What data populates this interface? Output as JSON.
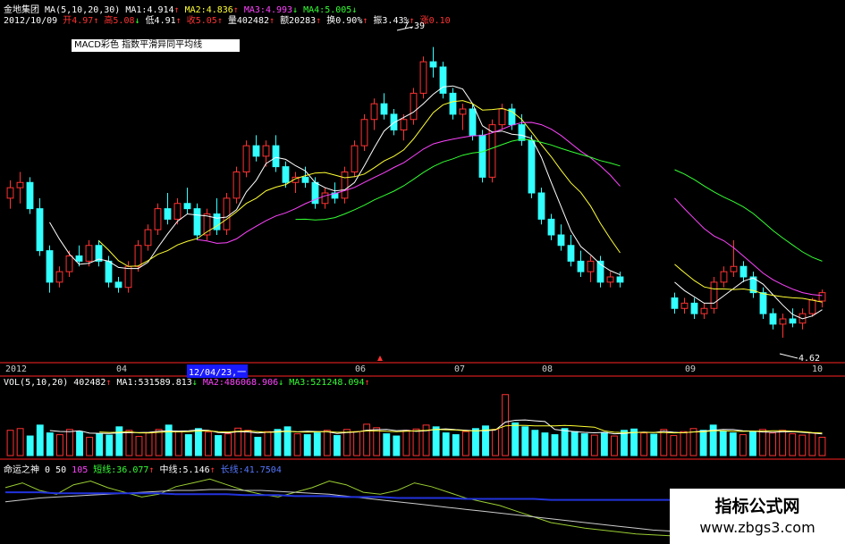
{
  "header": {
    "stock_name": "金地集团",
    "ma_params": "MA(5,10,20,30)",
    "ma1": "MA1:4.914",
    "ma2": "MA2:4.836",
    "ma3": "MA3:4.993",
    "ma4": "MA4:5.005",
    "date": "2012/10/09",
    "open": "开4.97",
    "high": "高5.08",
    "low": "低4.91",
    "close": "收5.05",
    "volume": "量402482",
    "amount": "额20283",
    "turnover": "换0.90%",
    "amplitude": "振3.43%",
    "change": "涨0.10"
  },
  "legend_box": "MACD彩色    指数平滑异同平均线",
  "price_chart": {
    "high_label": "7.39",
    "low_label": "4.62"
  },
  "x_axis": {
    "labels": [
      "2012",
      "04",
      "06",
      "07",
      "08",
      "09",
      "10"
    ],
    "cursor_date": "12/04/23,一"
  },
  "volume_panel": {
    "params": "VOL(5,10,20)",
    "vol": "402482",
    "ma1": "MA1:531589.813",
    "ma2": "MA2:486068.906",
    "ma3": "MA3:521248.094"
  },
  "indicator_panel": {
    "name": "命运之神",
    "p1": "0",
    "p2": "50",
    "p3": "105",
    "short": "短线:36.077",
    "mid": "中线:5.146",
    "long": "长线:41.7504"
  },
  "watermark": {
    "title": "指标公式网",
    "url": "www.zbgs3.com"
  },
  "colors": {
    "up": "#ff3333",
    "down": "#33ffff",
    "ma5": "#ffffff",
    "ma10": "#ffff33",
    "ma20": "#ff44ff",
    "ma30": "#33ff33"
  },
  "chart_data": [
    {
      "type": "candlestick",
      "title": "",
      "period": [
        "2012-01",
        "2012-10"
      ],
      "ylim": [
        4.4,
        7.6
      ],
      "candles": [
        {
          "o": 5.95,
          "h": 6.12,
          "l": 5.85,
          "c": 6.05
        },
        {
          "o": 6.05,
          "h": 6.2,
          "l": 5.9,
          "c": 6.1
        },
        {
          "o": 6.1,
          "h": 6.15,
          "l": 5.8,
          "c": 5.85
        },
        {
          "o": 5.85,
          "h": 5.95,
          "l": 5.4,
          "c": 5.45
        },
        {
          "o": 5.45,
          "h": 5.5,
          "l": 5.05,
          "c": 5.15
        },
        {
          "o": 5.15,
          "h": 5.3,
          "l": 5.1,
          "c": 5.25
        },
        {
          "o": 5.25,
          "h": 5.45,
          "l": 5.2,
          "c": 5.4
        },
        {
          "o": 5.4,
          "h": 5.5,
          "l": 5.3,
          "c": 5.35
        },
        {
          "o": 5.35,
          "h": 5.55,
          "l": 5.3,
          "c": 5.5
        },
        {
          "o": 5.5,
          "h": 5.55,
          "l": 5.3,
          "c": 5.35
        },
        {
          "o": 5.35,
          "h": 5.4,
          "l": 5.1,
          "c": 5.15
        },
        {
          "o": 5.15,
          "h": 5.2,
          "l": 5.05,
          "c": 5.1
        },
        {
          "o": 5.1,
          "h": 5.35,
          "l": 5.05,
          "c": 5.3
        },
        {
          "o": 5.3,
          "h": 5.55,
          "l": 5.25,
          "c": 5.5
        },
        {
          "o": 5.5,
          "h": 5.7,
          "l": 5.45,
          "c": 5.65
        },
        {
          "o": 5.65,
          "h": 5.9,
          "l": 5.6,
          "c": 5.85
        },
        {
          "o": 5.85,
          "h": 6.0,
          "l": 5.7,
          "c": 5.75
        },
        {
          "o": 5.75,
          "h": 5.95,
          "l": 5.7,
          "c": 5.9
        },
        {
          "o": 5.9,
          "h": 6.05,
          "l": 5.8,
          "c": 5.85
        },
        {
          "o": 5.85,
          "h": 5.9,
          "l": 5.55,
          "c": 5.6
        },
        {
          "o": 5.6,
          "h": 5.85,
          "l": 5.55,
          "c": 5.8
        },
        {
          "o": 5.8,
          "h": 5.95,
          "l": 5.6,
          "c": 5.65
        },
        {
          "o": 5.65,
          "h": 6.0,
          "l": 5.6,
          "c": 5.95
        },
        {
          "o": 5.95,
          "h": 6.25,
          "l": 5.9,
          "c": 6.2
        },
        {
          "o": 6.2,
          "h": 6.5,
          "l": 6.15,
          "c": 6.45
        },
        {
          "o": 6.45,
          "h": 6.55,
          "l": 6.3,
          "c": 6.35
        },
        {
          "o": 6.35,
          "h": 6.5,
          "l": 6.25,
          "c": 6.45
        },
        {
          "o": 6.45,
          "h": 6.55,
          "l": 6.2,
          "c": 6.25
        },
        {
          "o": 6.25,
          "h": 6.3,
          "l": 6.05,
          "c": 6.1
        },
        {
          "o": 6.1,
          "h": 6.2,
          "l": 6.0,
          "c": 6.15
        },
        {
          "o": 6.15,
          "h": 6.25,
          "l": 6.05,
          "c": 6.1
        },
        {
          "o": 6.1,
          "h": 6.15,
          "l": 5.85,
          "c": 5.9
        },
        {
          "o": 5.9,
          "h": 6.05,
          "l": 5.85,
          "c": 6.0
        },
        {
          "o": 6.0,
          "h": 6.1,
          "l": 5.9,
          "c": 5.95
        },
        {
          "o": 5.95,
          "h": 6.25,
          "l": 5.9,
          "c": 6.2
        },
        {
          "o": 6.2,
          "h": 6.5,
          "l": 6.15,
          "c": 6.45
        },
        {
          "o": 6.45,
          "h": 6.75,
          "l": 6.4,
          "c": 6.7
        },
        {
          "o": 6.7,
          "h": 6.9,
          "l": 6.6,
          "c": 6.85
        },
        {
          "o": 6.85,
          "h": 6.95,
          "l": 6.7,
          "c": 6.75
        },
        {
          "o": 6.75,
          "h": 6.8,
          "l": 6.55,
          "c": 6.6
        },
        {
          "o": 6.6,
          "h": 6.75,
          "l": 6.5,
          "c": 6.7
        },
        {
          "o": 6.7,
          "h": 7.0,
          "l": 6.65,
          "c": 6.95
        },
        {
          "o": 6.95,
          "h": 7.3,
          "l": 6.9,
          "c": 7.25
        },
        {
          "o": 7.25,
          "h": 7.39,
          "l": 7.1,
          "c": 7.2
        },
        {
          "o": 7.2,
          "h": 7.25,
          "l": 6.9,
          "c": 6.95
        },
        {
          "o": 6.95,
          "h": 7.0,
          "l": 6.7,
          "c": 6.75
        },
        {
          "o": 6.75,
          "h": 6.85,
          "l": 6.6,
          "c": 6.8
        },
        {
          "o": 6.8,
          "h": 6.85,
          "l": 6.5,
          "c": 6.55
        },
        {
          "o": 6.55,
          "h": 6.6,
          "l": 6.1,
          "c": 6.15
        },
        {
          "o": 6.15,
          "h": 6.7,
          "l": 6.1,
          "c": 6.65
        },
        {
          "o": 6.65,
          "h": 6.85,
          "l": 6.6,
          "c": 6.8
        },
        {
          "o": 6.8,
          "h": 6.85,
          "l": 6.6,
          "c": 6.65
        },
        {
          "o": 6.65,
          "h": 6.75,
          "l": 6.45,
          "c": 6.5
        },
        {
          "o": 6.5,
          "h": 6.55,
          "l": 5.95,
          "c": 6.0
        },
        {
          "o": 6.0,
          "h": 6.05,
          "l": 5.7,
          "c": 5.75
        },
        {
          "o": 5.75,
          "h": 5.8,
          "l": 5.55,
          "c": 5.6
        },
        {
          "o": 5.6,
          "h": 5.7,
          "l": 5.45,
          "c": 5.5
        },
        {
          "o": 5.5,
          "h": 5.6,
          "l": 5.3,
          "c": 5.35
        },
        {
          "o": 5.35,
          "h": 5.45,
          "l": 5.2,
          "c": 5.25
        },
        {
          "o": 5.25,
          "h": 5.4,
          "l": 5.15,
          "c": 5.35
        },
        {
          "o": 5.35,
          "h": 5.4,
          "l": 5.1,
          "c": 5.15
        },
        {
          "o": 5.15,
          "h": 5.25,
          "l": 5.1,
          "c": 5.2
        },
        {
          "o": 5.2,
          "h": 5.25,
          "l": 5.1,
          "c": 5.15
        },
        {
          "o": 5.0,
          "h": 5.05,
          "l": 4.85,
          "c": 4.9
        },
        {
          "o": 4.9,
          "h": 5.0,
          "l": 4.85,
          "c": 4.95
        },
        {
          "o": 4.95,
          "h": 5.0,
          "l": 4.8,
          "c": 4.85
        },
        {
          "o": 4.85,
          "h": 4.95,
          "l": 4.8,
          "c": 4.9
        },
        {
          "o": 4.9,
          "h": 5.2,
          "l": 4.85,
          "c": 5.15
        },
        {
          "o": 5.15,
          "h": 5.3,
          "l": 5.1,
          "c": 5.25
        },
        {
          "o": 5.25,
          "h": 5.55,
          "l": 5.2,
          "c": 5.3
        },
        {
          "o": 5.3,
          "h": 5.35,
          "l": 5.15,
          "c": 5.2
        },
        {
          "o": 5.2,
          "h": 5.25,
          "l": 5.0,
          "c": 5.05
        },
        {
          "o": 5.05,
          "h": 5.1,
          "l": 4.8,
          "c": 4.85
        },
        {
          "o": 4.85,
          "h": 4.9,
          "l": 4.7,
          "c": 4.75
        },
        {
          "o": 4.75,
          "h": 4.85,
          "l": 4.62,
          "c": 4.8
        },
        {
          "o": 4.8,
          "h": 4.9,
          "l": 4.72,
          "c": 4.76
        },
        {
          "o": 4.76,
          "h": 4.9,
          "l": 4.7,
          "c": 4.85
        },
        {
          "o": 4.85,
          "h": 5.0,
          "l": 4.82,
          "c": 4.98
        },
        {
          "o": 4.97,
          "h": 5.08,
          "l": 4.91,
          "c": 5.05
        }
      ]
    },
    {
      "type": "bar",
      "title": "",
      "values": [
        58,
        62,
        45,
        70,
        52,
        48,
        60,
        55,
        42,
        50,
        47,
        66,
        58,
        44,
        52,
        60,
        70,
        55,
        48,
        62,
        54,
        46,
        50,
        63,
        58,
        42,
        55,
        60,
        66,
        50,
        48,
        52,
        58,
        46,
        60,
        55,
        72,
        64,
        50,
        45,
        58,
        61,
        70,
        66,
        52,
        48,
        55,
        62,
        68,
        60,
        140,
        75,
        66,
        58,
        52,
        48,
        62,
        55,
        50,
        47,
        53,
        45,
        58,
        61,
        52,
        49,
        60,
        46,
        55,
        62,
        58,
        70,
        56,
        52,
        48,
        55,
        60,
        52,
        58,
        50,
        47,
        52,
        42
      ],
      "ylim": [
        0,
        160
      ]
    },
    {
      "type": "line",
      "title": "",
      "series": [
        {
          "name": "短线",
          "values": [
            55,
            60,
            52,
            48,
            58,
            62,
            55,
            50,
            45,
            48,
            56,
            60,
            64,
            58,
            52,
            48,
            45,
            50,
            55,
            62,
            58,
            50,
            48,
            52,
            60,
            56,
            50,
            44,
            40,
            36,
            30,
            24,
            18,
            15,
            12,
            10,
            8,
            6,
            5,
            4,
            3,
            4,
            6,
            5,
            4,
            3,
            2,
            3,
            4,
            3
          ]
        },
        {
          "name": "中线",
          "values": [
            40,
            42,
            44,
            45,
            46,
            47,
            48,
            49,
            50,
            51,
            52,
            52,
            53,
            53,
            52,
            52,
            51,
            50,
            49,
            48,
            46,
            44,
            42,
            40,
            38,
            36,
            34,
            32,
            30,
            28,
            26,
            24,
            22,
            20,
            18,
            16,
            14,
            12,
            10,
            9,
            8,
            7,
            6,
            6,
            5,
            5,
            5,
            5,
            5,
            5
          ]
        },
        {
          "name": "长线",
          "values": [
            50,
            50,
            50,
            49,
            49,
            49,
            49,
            49,
            49,
            49,
            48,
            48,
            48,
            48,
            47,
            47,
            47,
            46,
            46,
            46,
            45,
            45,
            45,
            44,
            44,
            44,
            44,
            43,
            43,
            43,
            43,
            43,
            42,
            42,
            42,
            42,
            42,
            42,
            42,
            42,
            42,
            42,
            42,
            42,
            42,
            42,
            42,
            42,
            42,
            42
          ]
        }
      ],
      "ylim": [
        0,
        70
      ]
    }
  ]
}
